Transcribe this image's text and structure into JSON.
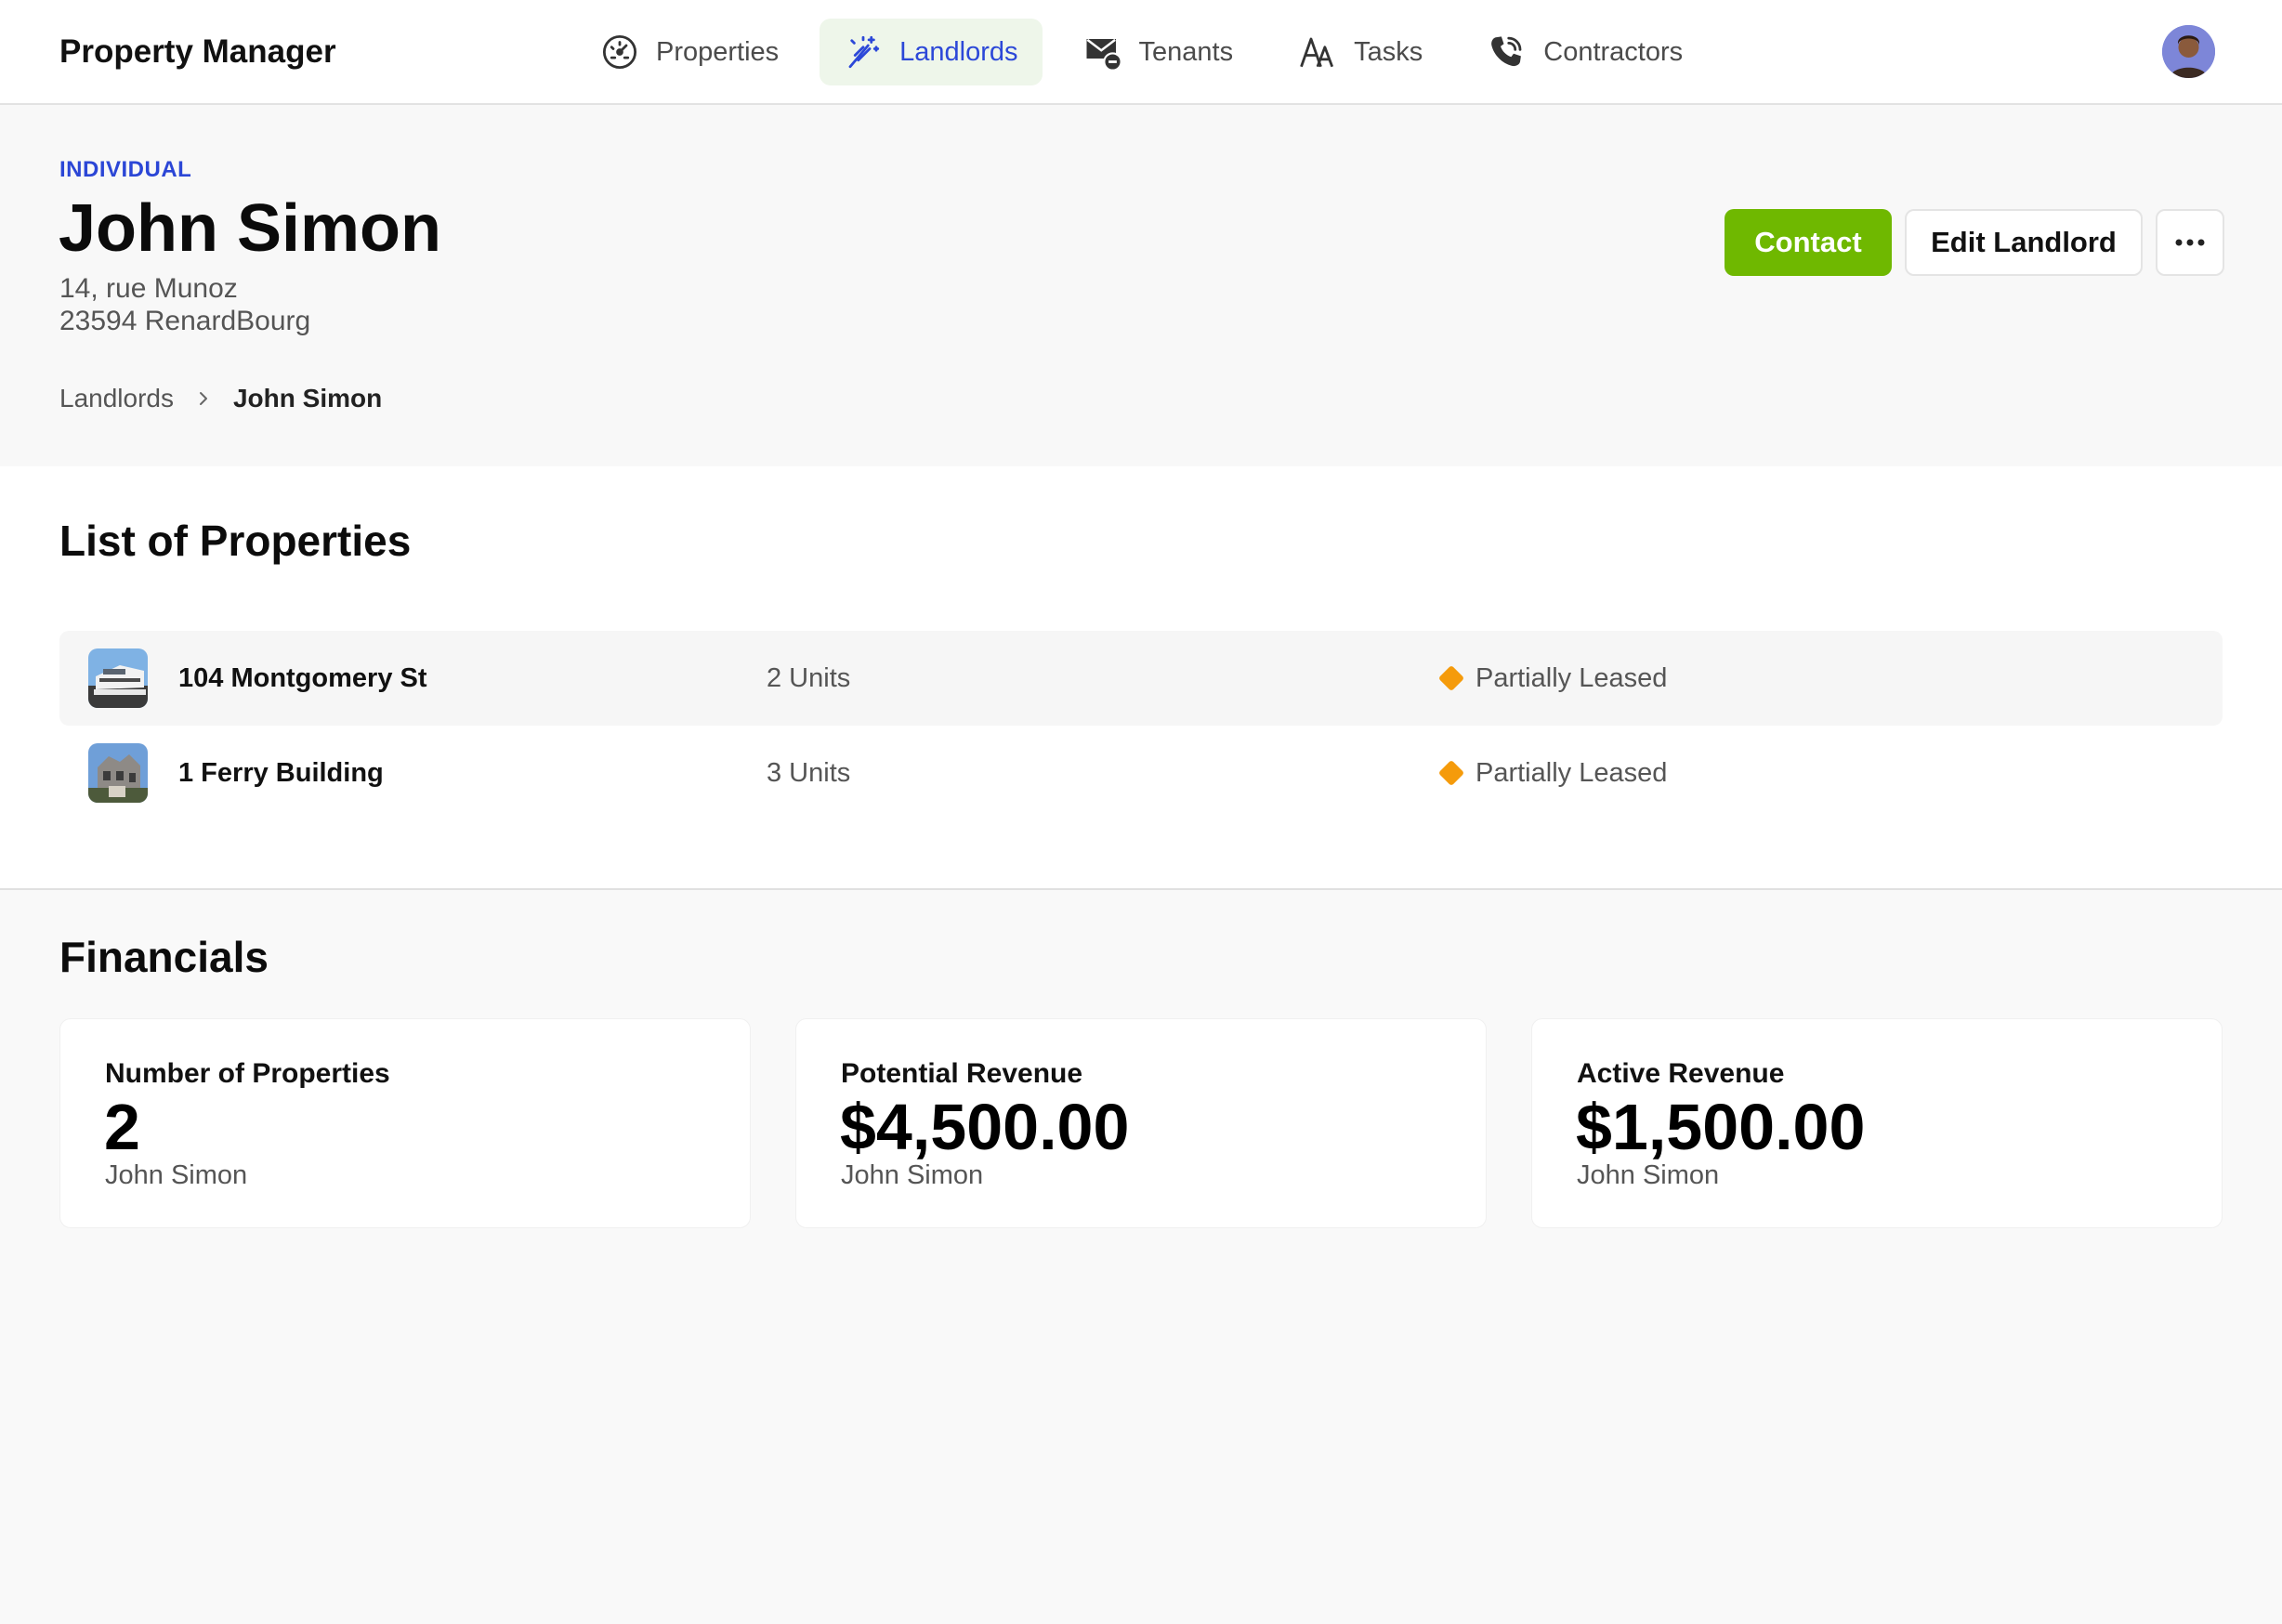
{
  "app": {
    "title": "Property Manager"
  },
  "nav": {
    "items": [
      {
        "label": "Properties",
        "icon": "speedometer-icon",
        "active": false
      },
      {
        "label": "Landlords",
        "icon": "sparkle-wand-icon",
        "active": true
      },
      {
        "label": "Tenants",
        "icon": "mail-minus-icon",
        "active": false
      },
      {
        "label": "Tasks",
        "icon": "font-size-icon",
        "active": false
      },
      {
        "label": "Contractors",
        "icon": "phone-ringing-icon",
        "active": false
      }
    ]
  },
  "user": {
    "avatar": "user-avatar"
  },
  "landlord": {
    "type": "INDIVIDUAL",
    "name": "John Simon",
    "address_line1": "14, rue Munoz",
    "address_line2": "23594 RenardBourg"
  },
  "breadcrumb": {
    "parent": "Landlords",
    "current": "John Simon"
  },
  "actions": {
    "contact": "Contact",
    "edit": "Edit Landlord",
    "more_icon": "more-horizontal-icon"
  },
  "properties": {
    "title": "List of Properties",
    "items": [
      {
        "name": "104 Montgomery St",
        "units": "2 Units",
        "status": "Partially Leased"
      },
      {
        "name": "1 Ferry Building",
        "units": "3 Units",
        "status": "Partially Leased"
      }
    ]
  },
  "financials": {
    "title": "Financials",
    "cards": [
      {
        "label": "Number of Properties",
        "value": "2",
        "sub": "John Simon"
      },
      {
        "label": "Potential Revenue",
        "value": "$4,500.00",
        "sub": "John Simon"
      },
      {
        "label": "Active Revenue",
        "value": "$1,500.00",
        "sub": "John Simon"
      }
    ]
  },
  "colors": {
    "accent_blue": "#2c48d8",
    "primary_green": "#6fb800",
    "status_orange": "#f59b0b",
    "active_nav_bg": "#eef6ea"
  }
}
